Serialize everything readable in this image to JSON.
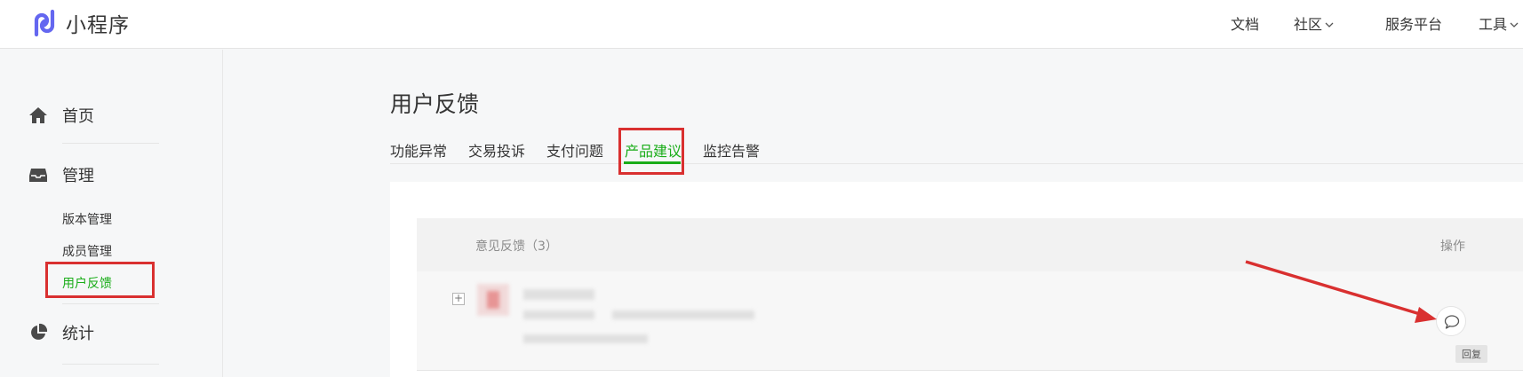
{
  "header": {
    "brand": "小程序",
    "nav": {
      "docs": "文档",
      "community": "社区",
      "services": "服务平台",
      "tools": "工具"
    }
  },
  "sidebar": {
    "home": "首页",
    "manage": "管理",
    "manage_items": [
      "版本管理",
      "成员管理",
      "用户反馈"
    ],
    "stats": "统计"
  },
  "main": {
    "title": "用户反馈",
    "tabs": [
      "功能异常",
      "交易投诉",
      "支付问题",
      "产品建议",
      "监控告警"
    ],
    "active_tab": "产品建议",
    "table": {
      "col_feedback": "意见反馈（3）",
      "col_action": "操作",
      "expand_symbol": "+",
      "reply_tooltip": "回复"
    }
  },
  "colors": {
    "accent_green": "#1aad19",
    "highlight_red": "#d93030",
    "logo_purple": "#6467f0"
  }
}
